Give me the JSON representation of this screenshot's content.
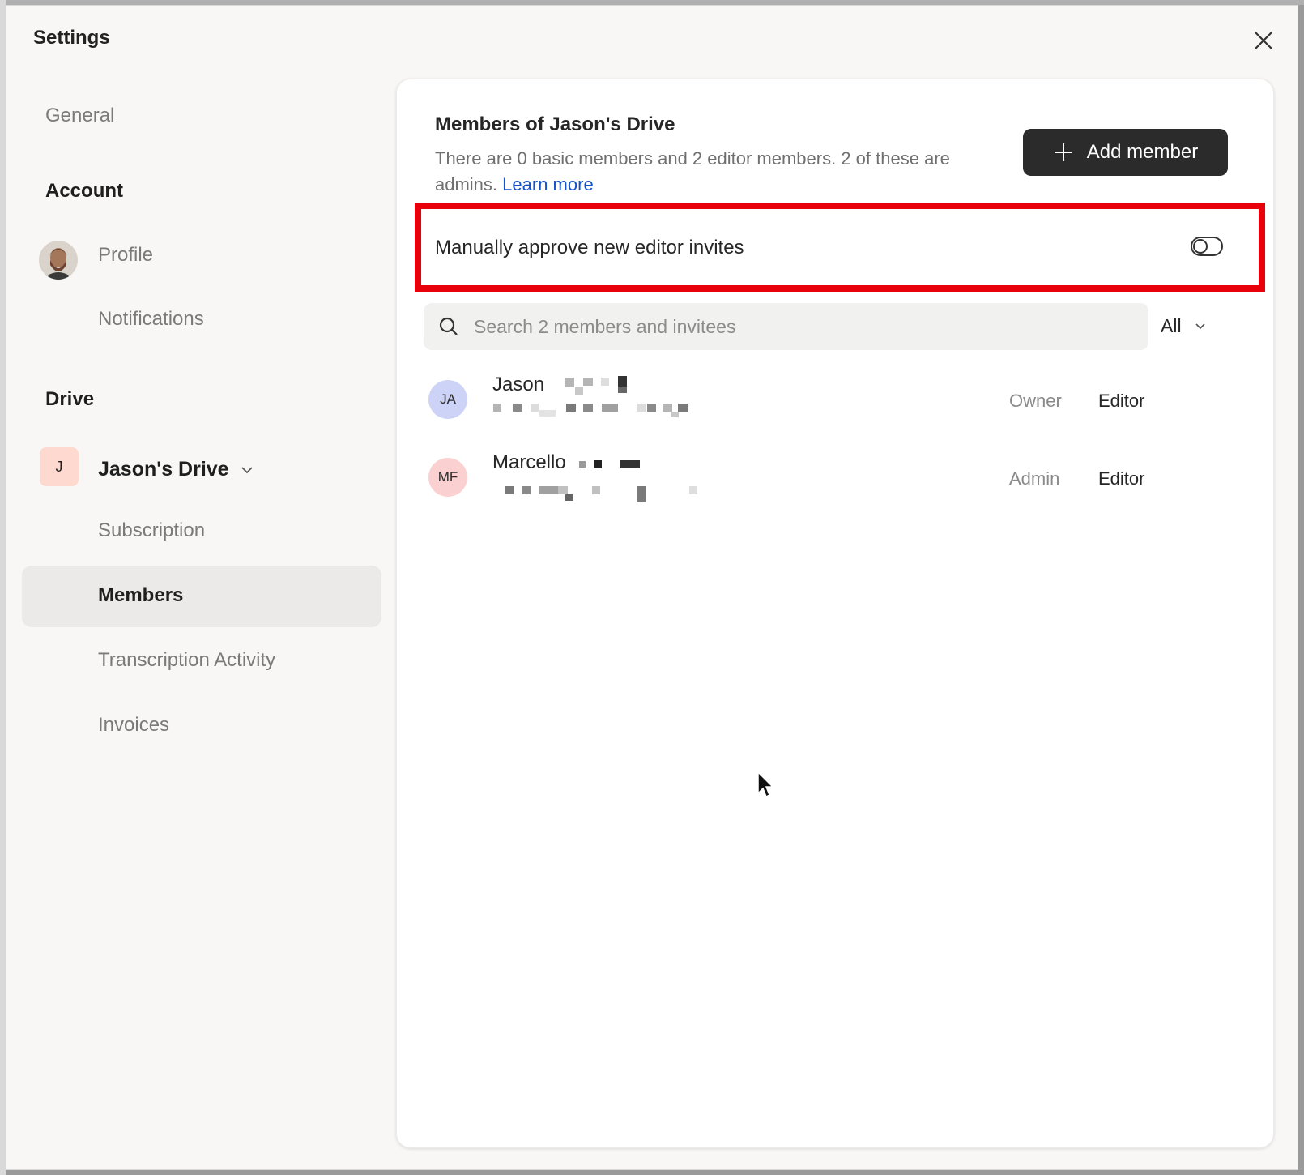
{
  "window": {
    "title": "Settings"
  },
  "sidebar": {
    "general": "General",
    "account_heading": "Account",
    "profile": "Profile",
    "notifications": "Notifications",
    "drive_heading": "Drive",
    "drive_badge": "J",
    "drive_name": "Jason's Drive",
    "subscription": "Subscription",
    "members": "Members",
    "transcription": "Transcription Activity",
    "invoices": "Invoices"
  },
  "main": {
    "title": "Members of Jason's Drive",
    "description": "There are 0 basic members and 2 editor members. 2 of these are admins.",
    "learn_more": "Learn more",
    "add_member": "Add member",
    "toggle_label": "Manually approve new editor invites",
    "toggle_on": false,
    "search_placeholder": "Search 2 members and invitees",
    "filter_value": "All",
    "members": [
      {
        "initials": "JA",
        "name": "Jason",
        "role": "Owner",
        "access": "Editor",
        "avatar_color": "#cdd3f7"
      },
      {
        "initials": "MF",
        "name": "Marcello",
        "role": "Admin",
        "access": "Editor",
        "avatar_color": "#fbd0d0"
      }
    ]
  },
  "colors": {
    "highlight": "#e8000b",
    "link": "#1553c9",
    "button_bg": "#2b2b2b"
  }
}
